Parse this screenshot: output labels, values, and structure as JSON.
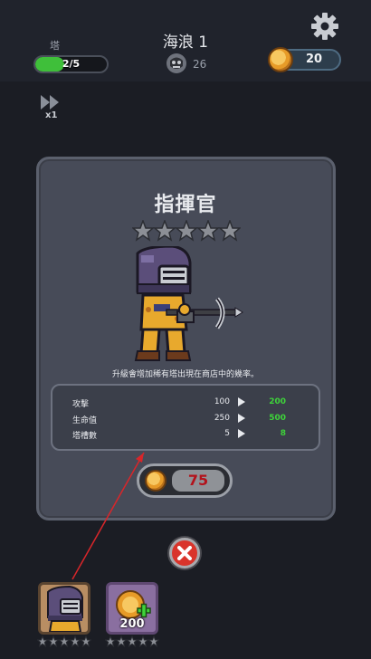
{
  "top_bar": {
    "tower_label": "塔",
    "tower_progress_text": "2/5",
    "tower_progress_fraction": 0.4,
    "wave_title": "海浪 1",
    "enemy_count": "26",
    "coins": "20"
  },
  "speed": {
    "label": "x1"
  },
  "panel": {
    "title": "指揮官",
    "stars_total": 5,
    "stars_filled": 0,
    "description": "升級會增加稀有塔出現在商店中的幾率。",
    "stats": [
      {
        "name": "攻擊",
        "current": "100",
        "next": "200"
      },
      {
        "name": "生命值",
        "current": "250",
        "next": "500"
      },
      {
        "name": "塔槽數",
        "current": "5",
        "next": "8"
      }
    ],
    "upgrade_price": "75"
  },
  "cards": {
    "coin_card_value": "200"
  },
  "colors": {
    "accent_green": "#3ed33a",
    "price_red": "#b3121b",
    "close_red": "#d9342b"
  }
}
